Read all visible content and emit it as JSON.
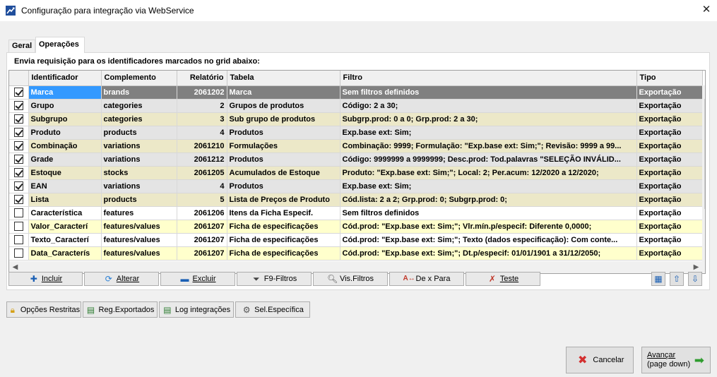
{
  "window": {
    "title": "Configuração para integração via WebService",
    "close_glyph": "✕"
  },
  "tabs": [
    {
      "label": "Geral"
    },
    {
      "label": "Operações"
    }
  ],
  "instruction": "Envia requisição para os identificadores marcados no grid abaixo:",
  "grid": {
    "columns": [
      "",
      "Identificador",
      "Complemento",
      "Relatório",
      "Tabela",
      "Filtro",
      "Tipo"
    ],
    "rows": [
      {
        "checked": true,
        "style": "sel",
        "id": "Marca",
        "comp": "brands",
        "rel": "2061202",
        "tab": "Marca",
        "filtro": "Sem filtros definidos",
        "tipo": "Exportação"
      },
      {
        "checked": true,
        "style": "gray",
        "id": "Grupo",
        "comp": "categories",
        "rel": "2",
        "tab": "Grupos de produtos",
        "filtro": "Código: 2 a 30;",
        "tipo": "Exportação"
      },
      {
        "checked": true,
        "style": "beige",
        "id": "Subgrupo",
        "comp": "categories",
        "rel": "3",
        "tab": "Sub grupo de produtos",
        "filtro": "Subgrp.prod: 0 a 0; Grp.prod: 2 a 30;",
        "tipo": "Exportação"
      },
      {
        "checked": true,
        "style": "gray",
        "id": "Produto",
        "comp": "products",
        "rel": "4",
        "tab": "Produtos",
        "filtro": "Exp.base ext: Sim;",
        "tipo": "Exportação"
      },
      {
        "checked": true,
        "style": "beige",
        "id": "Combinação",
        "comp": "variations",
        "rel": "2061210",
        "tab": "Formulações",
        "filtro": "Combinação: 9999; Formulação: \"Exp.base ext: Sim;\"; Revisão: 9999 a 99...",
        "tipo": "Exportação"
      },
      {
        "checked": true,
        "style": "gray",
        "id": "Grade",
        "comp": "variations",
        "rel": "2061212",
        "tab": "Produtos",
        "filtro": "Código: 9999999 a 9999999; Desc.prod: Tod.palavras \"SELEÇÃO INVÁLID...",
        "tipo": "Exportação"
      },
      {
        "checked": true,
        "style": "beige",
        "id": "Estoque",
        "comp": "stocks",
        "rel": "2061205",
        "tab": "Acumulados de Estoque",
        "filtro": "Produto: \"Exp.base ext: Sim;\"; Local: 2; Per.acum: 12/2020 a 12/2020;",
        "tipo": "Exportação"
      },
      {
        "checked": true,
        "style": "gray",
        "id": "EAN",
        "comp": "variations",
        "rel": "4",
        "tab": "Produtos",
        "filtro": "Exp.base ext: Sim;",
        "tipo": "Exportação"
      },
      {
        "checked": true,
        "style": "beige",
        "id": "Lista",
        "comp": "products",
        "rel": "5",
        "tab": "Lista de Preços de Produto",
        "filtro": "Cód.lista: 2 a 2; Grp.prod: 0; Subgrp.prod: 0;",
        "tipo": "Exportação"
      },
      {
        "checked": false,
        "style": "white",
        "id": "Característica",
        "comp": "features",
        "rel": "2061206",
        "tab": "Itens da Ficha Especif.",
        "filtro": "Sem filtros definidos",
        "tipo": "Exportação"
      },
      {
        "checked": false,
        "style": "yellow",
        "id": "Valor_Caracterí",
        "comp": "features/values",
        "rel": "2061207",
        "tab": "Ficha de especificações",
        "filtro": "Cód.prod: \"Exp.base ext: Sim;\"; Vlr.mín.p/especif: Diferente 0,0000;",
        "tipo": "Exportação"
      },
      {
        "checked": false,
        "style": "white",
        "id": "Texto_Caracterí",
        "comp": "features/values",
        "rel": "2061207",
        "tab": "Ficha de especificações",
        "filtro": "Cód.prod: \"Exp.base ext: Sim;\"; Texto (dados especificação): Com conte...",
        "tipo": "Exportação"
      },
      {
        "checked": false,
        "style": "yellow",
        "id": "Data_Caracterís",
        "comp": "features/values",
        "rel": "2061207",
        "tab": "Ficha de especificações",
        "filtro": "Cód.prod: \"Exp.base ext: Sim;\"; Dt.p/especif: 01/01/1901 a 31/12/2050;",
        "tipo": "Exportação"
      }
    ]
  },
  "toolbar": {
    "incluir": "Incluir",
    "alterar": "Alterar",
    "excluir": "Excluir",
    "filtros": "F9-Filtros",
    "vis_filtros": "Vis.Filtros",
    "de_x_para": "De x Para",
    "teste": "Teste"
  },
  "bottom_buttons": {
    "opcoes": "Opções Restritas",
    "reg": "Reg.Exportados",
    "log": "Log integrações",
    "sel": "Sel.Específica"
  },
  "dialog": {
    "cancelar": "Cancelar",
    "avancar_line1": "Avançar",
    "avancar_line2": "(page down)"
  },
  "colors": {
    "selected_row": "#808080",
    "selected_cell": "#3399ff",
    "row_gray": "#e4e4e4",
    "row_beige": "#ece8c8",
    "row_yellow": "#ffffcc"
  }
}
